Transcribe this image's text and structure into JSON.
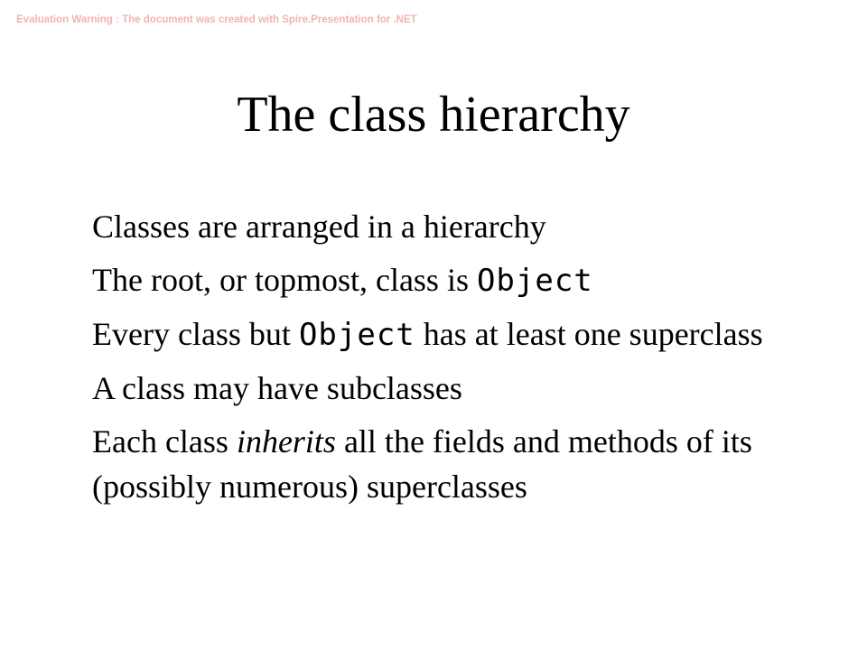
{
  "watermark": "Evaluation Warning : The document was created with  Spire.Presentation for .NET",
  "slide": {
    "title": "The class hierarchy",
    "bullets": [
      {
        "text": "Classes are arranged in a hierarchy"
      },
      {
        "pre": "The root, or topmost, class is ",
        "code": "Object"
      },
      {
        "pre": "Every class but ",
        "code": "Object",
        "post": " has at least one superclass"
      },
      {
        "text": "A class may have subclasses"
      },
      {
        "pre": "Each class ",
        "em": "inherits",
        "post": " all the fields and methods of its (possibly numerous) superclasses"
      }
    ]
  },
  "colors": {
    "watermark": "#f2b3b3",
    "text": "#000000",
    "background": "#ffffff"
  }
}
